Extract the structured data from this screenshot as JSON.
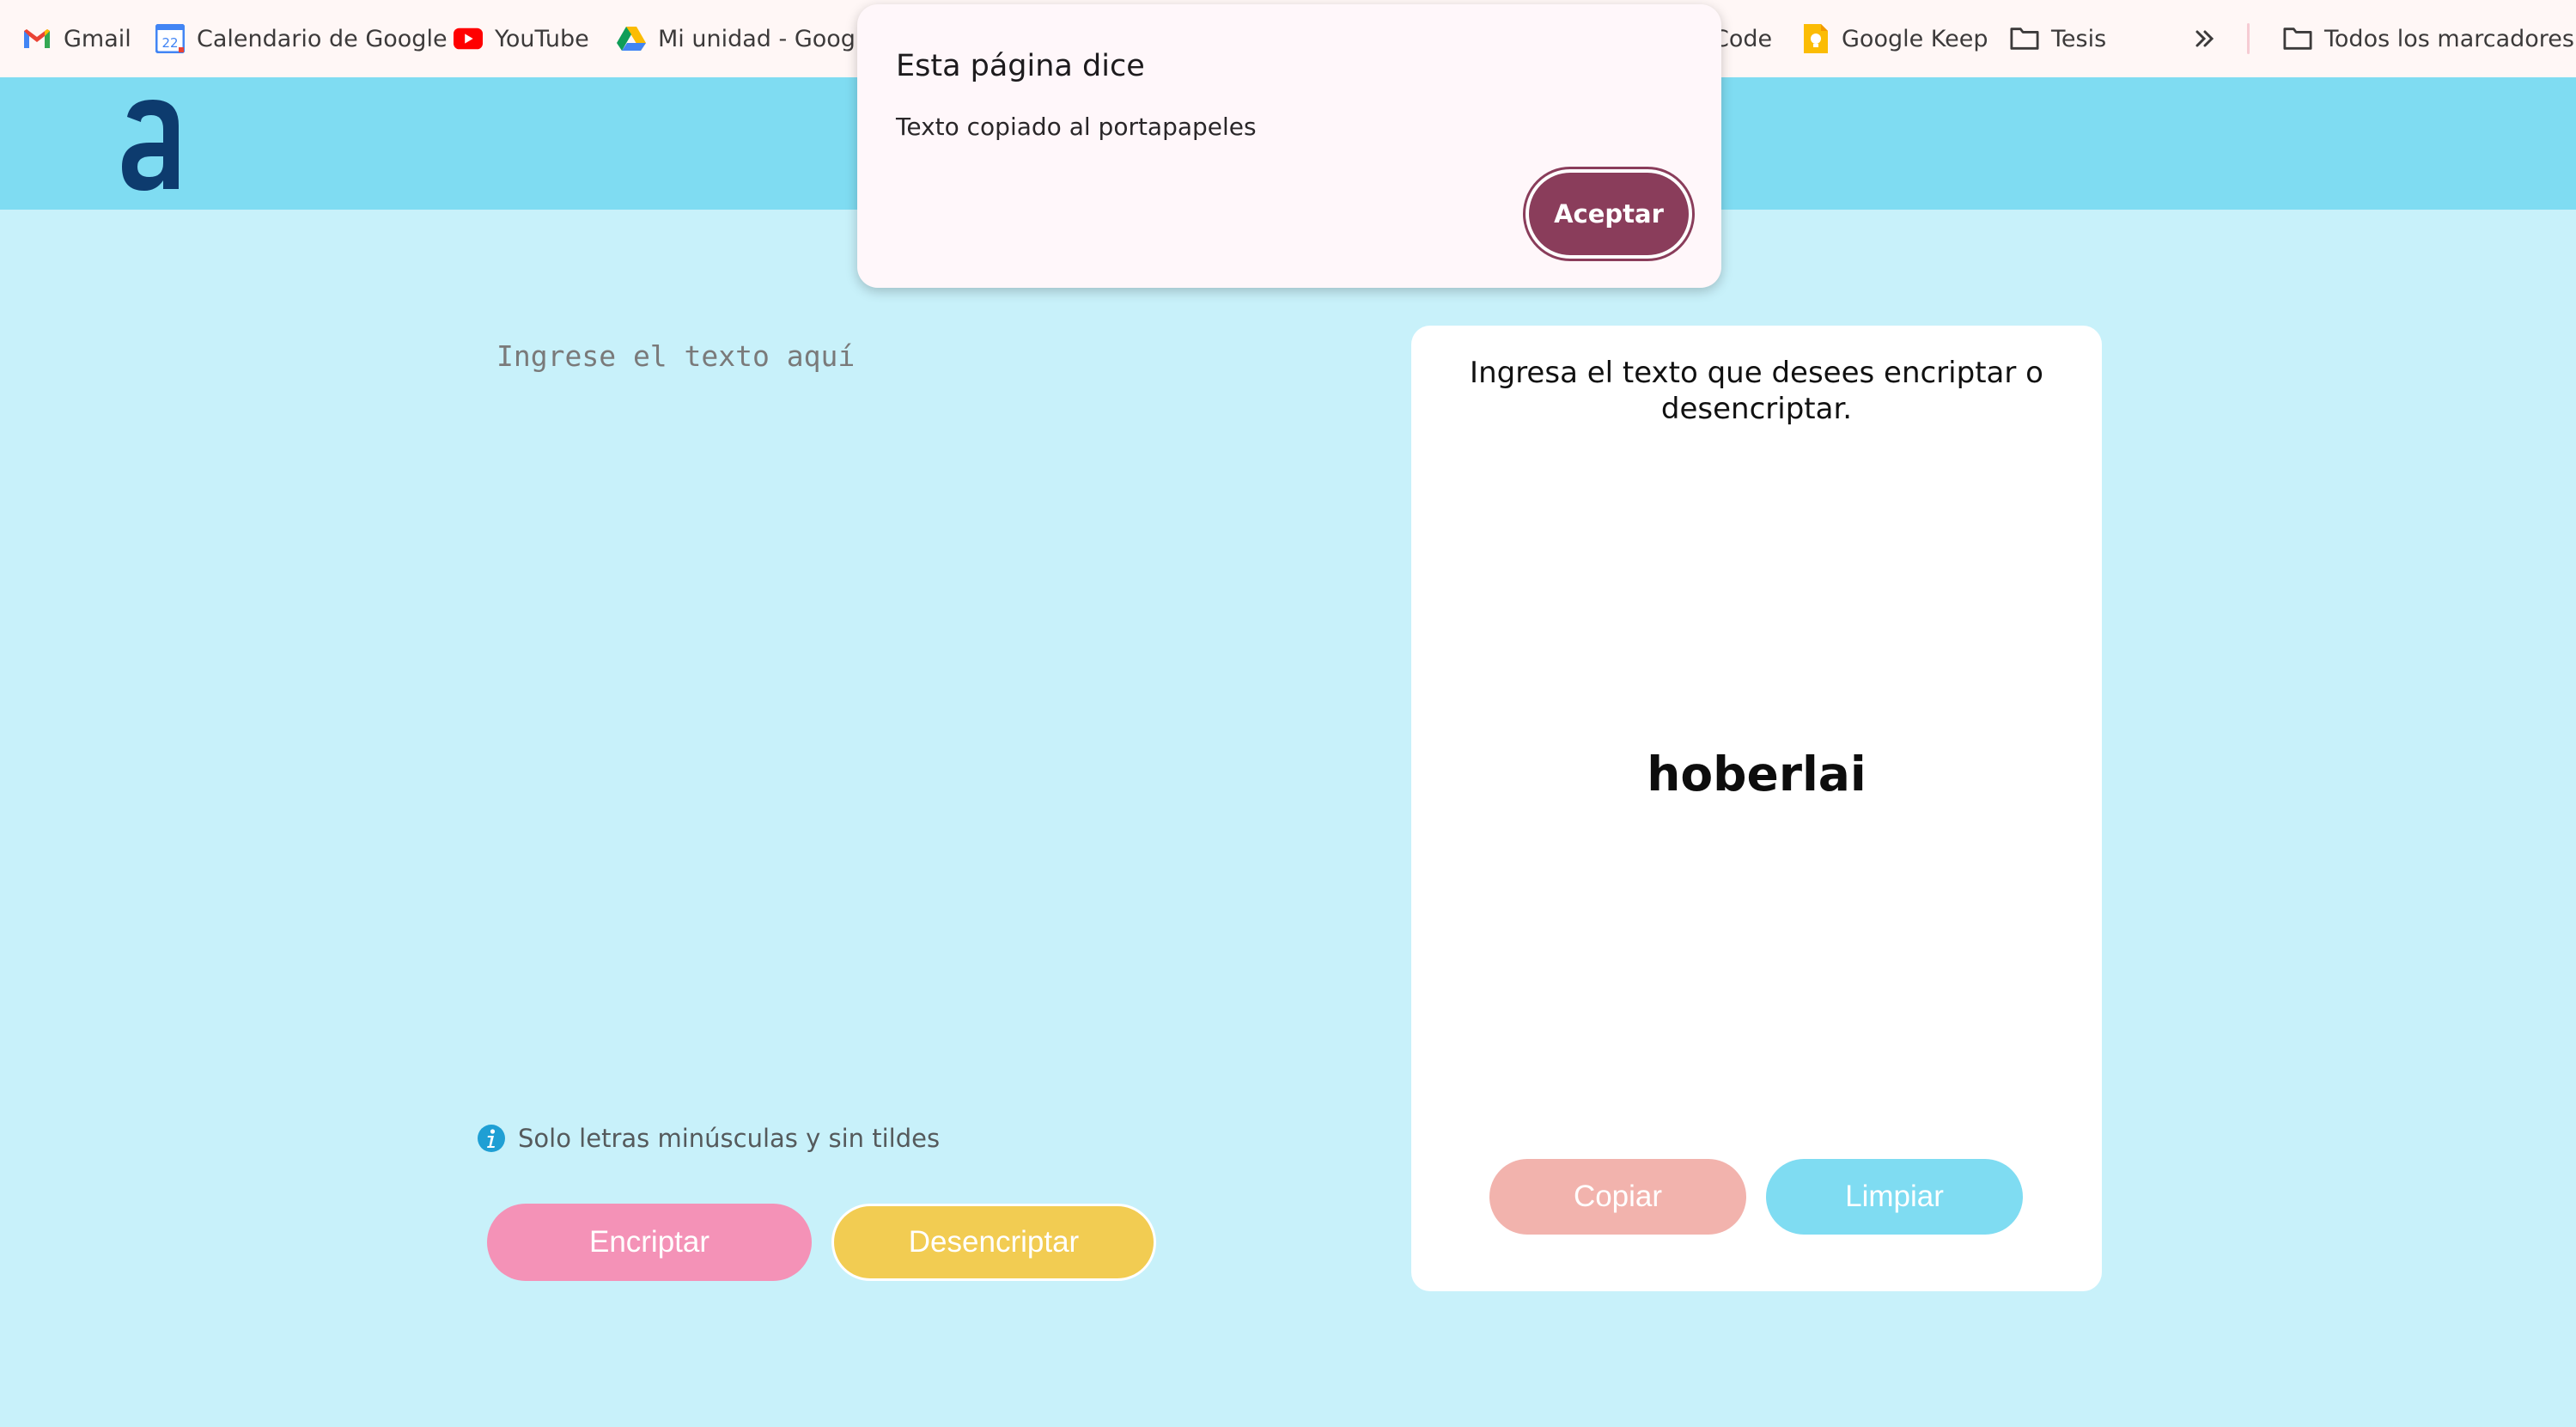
{
  "bookmarks": {
    "items": [
      {
        "label": "Gmail",
        "icon": "gmail-icon"
      },
      {
        "label": "Calendario de Google",
        "icon": "calendar-icon",
        "badge": "22"
      },
      {
        "label": "YouTube",
        "icon": "youtube-icon"
      },
      {
        "label": "Mi unidad - Google",
        "icon": "drive-icon"
      },
      {
        "label": "Code",
        "icon": "code-icon"
      },
      {
        "label": "Google Keep",
        "icon": "keep-icon"
      },
      {
        "label": "Tesis",
        "icon": "folder-icon"
      }
    ],
    "overflow_icon": "double-chevron-icon",
    "all_bookmarks": {
      "label": "Todos los marcadores",
      "icon": "folder-icon"
    }
  },
  "header": {
    "logo_letter": "a",
    "logo_color": "#0d3b6e",
    "background": "#7fdcf2"
  },
  "input": {
    "placeholder": "Ingrese el texto aquí",
    "value": ""
  },
  "hint": {
    "icon": "info-icon",
    "text": "Solo letras minúsculas y sin tildes"
  },
  "buttons": {
    "encrypt": "Encriptar",
    "decrypt": "Desencriptar",
    "copy": "Copiar",
    "clear": "Limpiar"
  },
  "output": {
    "message": "Ingresa el texto que desees encriptar o desencriptar.",
    "result": "hoberlai"
  },
  "dialog": {
    "title": "Esta página dice",
    "message": "Texto copiado al portapapeles",
    "button": "Aceptar",
    "button_color": "#8a3d5b"
  },
  "colors": {
    "page_bg": "#c8f1fa",
    "encrypt": "#f492b7",
    "decrypt": "#f2cc52",
    "copy": "#f2b3ad",
    "clear": "#7fdcf2"
  }
}
